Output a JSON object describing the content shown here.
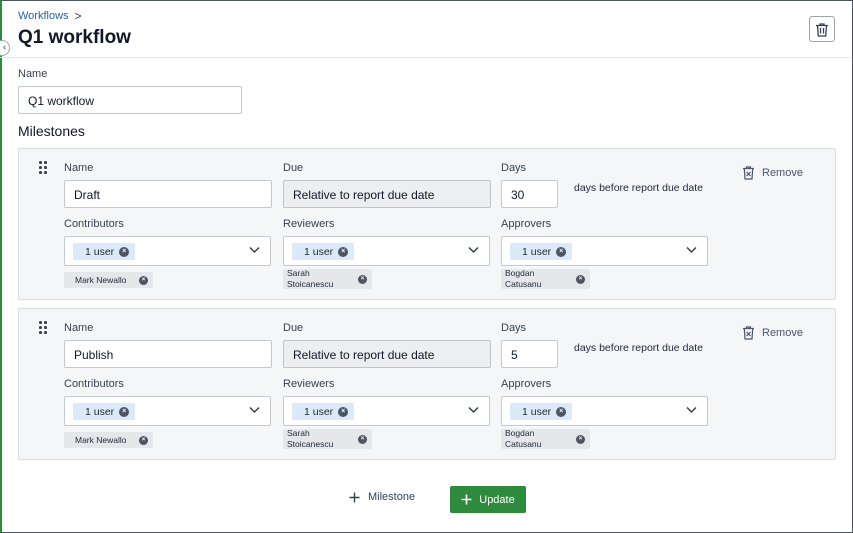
{
  "breadcrumb": {
    "parent": "Workflows",
    "separator": ">"
  },
  "page": {
    "title": "Q1 workflow"
  },
  "header": {
    "trash_icon": "trash-icon"
  },
  "name_field": {
    "label": "Name",
    "value": "Q1 workflow"
  },
  "milestones_section": {
    "title": "Milestones"
  },
  "milestones": [
    {
      "name_label": "Name",
      "name_value": "Draft",
      "due_label": "Due",
      "due_value": "Relative to report due date",
      "days_label": "Days",
      "days_value": "30",
      "days_suffix": "days before report due date",
      "remove_label": "Remove",
      "contributors": {
        "label": "Contributors",
        "chip": "1 user",
        "people": [
          "Mark Newallo"
        ]
      },
      "reviewers": {
        "label": "Reviewers",
        "chip": "1 user",
        "people": [
          "Sarah",
          "Stoicanescu"
        ]
      },
      "approvers": {
        "label": "Approvers",
        "chip": "1 user",
        "people": [
          "Bogdan",
          "Catusanu"
        ]
      }
    },
    {
      "name_label": "Name",
      "name_value": "Publish",
      "due_label": "Due",
      "due_value": "Relative to report due date",
      "days_label": "Days",
      "days_value": "5",
      "days_suffix": "days before report due date",
      "remove_label": "Remove",
      "contributors": {
        "label": "Contributors",
        "chip": "1 user",
        "people": [
          "Mark Newallo"
        ]
      },
      "reviewers": {
        "label": "Reviewers",
        "chip": "1 user",
        "people": [
          "Sarah",
          "Stoicanescu"
        ]
      },
      "approvers": {
        "label": "Approvers",
        "chip": "1 user",
        "people": [
          "Bogdan",
          "Catusanu"
        ]
      }
    }
  ],
  "footer": {
    "add_milestone_label": "Milestone",
    "update_label": "Update"
  },
  "colors": {
    "accent_green": "#2e8b3e",
    "link_blue": "#2563a8",
    "chip_blue": "#dbe9f8"
  }
}
